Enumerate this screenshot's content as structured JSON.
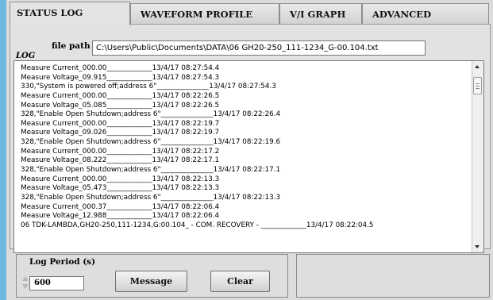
{
  "tabs": [
    {
      "label": "STATUS LOG",
      "active": true
    },
    {
      "label": "WAVEFORM PROFILE",
      "active": false
    },
    {
      "label": "V/I GRAPH",
      "active": false
    },
    {
      "label": "ADVANCED",
      "active": false
    }
  ],
  "log_label": "LOG",
  "file_path": {
    "label": "file path",
    "value": "C:\\Users\\Public\\Documents\\DATA\\06 GH20-250_111-1234_G-00.104.txt"
  },
  "log_lines": [
    "Measure Current_000.00_____________13/4/17 08:27:54.4",
    "Measure Voltage_09.915_____________13/4/17 08:27:54.3",
    "330,\"System is powered off;address 6\"_______________13/4/17 08:27:54.3",
    "Measure Current_000.00_____________13/4/17 08:22:26.5",
    "Measure Voltage_05.085_____________13/4/17 08:22:26.5",
    "328,\"Enable Open Shutdown;address 6\"_______________13/4/17 08:22:26.4",
    "Measure Current_000.00_____________13/4/17 08:22:19.7",
    "Measure Voltage_09.026_____________13/4/17 08:22:19.7",
    "328,\"Enable Open Shutdown;address 6\"_______________13/4/17 08:22:19.6",
    "Measure Current_000.00_____________13/4/17 08:22:17.2",
    "Measure Voltage_08.222_____________13/4/17 08:22:17.1",
    "328,\"Enable Open Shutdown;address 6\"_______________13/4/17 08:22:17.1",
    "Measure Current_000.00_____________13/4/17 08:22:13.3",
    "Measure Voltage_05.473_____________13/4/17 08:22:13.3",
    "328,\"Enable Open Shutdown;address 6\"_______________13/4/17 08:22:13.3",
    "Measure Current_000.37_____________13/4/17 08:22:06.4",
    "Measure Voltage_12.988_____________13/4/17 08:22:06.4",
    "06  TDK-LAMBDA,GH20-250,111-1234,G:00.104_ - COM. RECOVERY - _____________13/4/17 08:22:04.5"
  ],
  "log_period": {
    "label": "Log Period (s)",
    "value": "600"
  },
  "buttons": {
    "message": "Message",
    "clear": "Clear"
  }
}
